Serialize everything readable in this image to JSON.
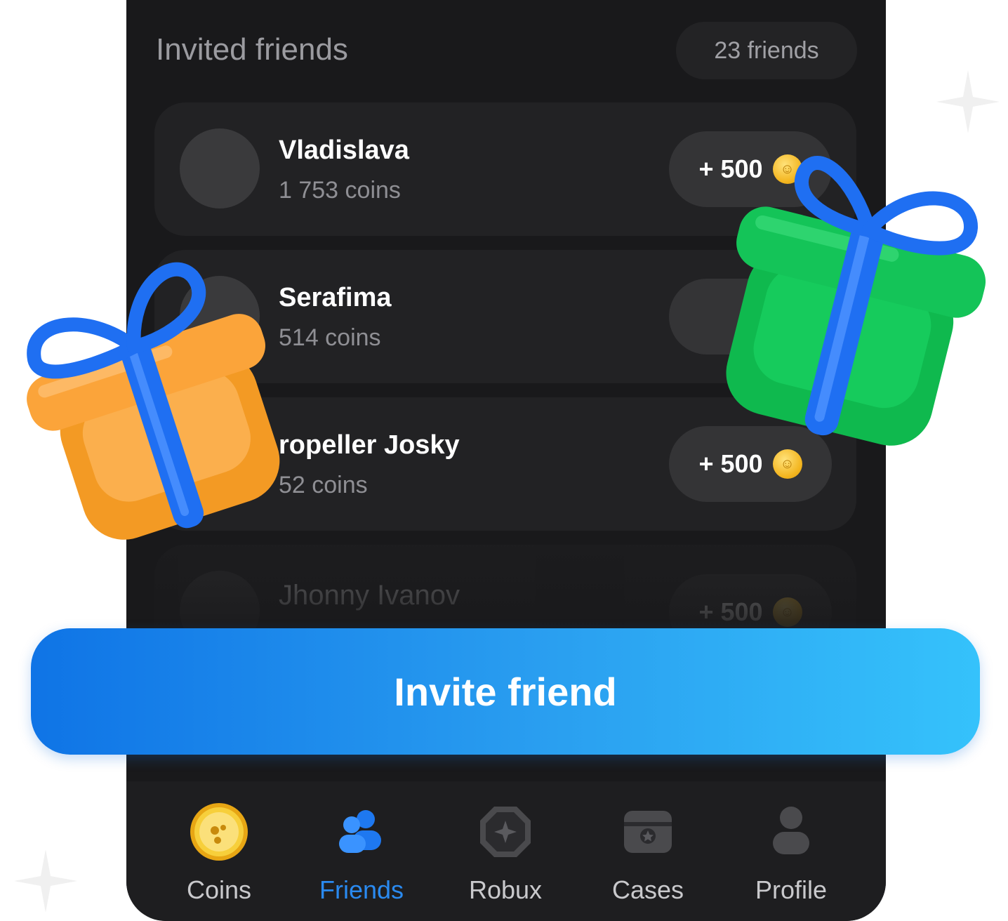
{
  "header": {
    "title": "Invited friends",
    "count": "23 friends"
  },
  "friends": [
    {
      "name": "Vladislava",
      "coins": "1 753 coins",
      "reward": "+ 500"
    },
    {
      "name": "Serafima",
      "coins": "514 coins",
      "reward": "+"
    },
    {
      "name": "ropeller Josky",
      "coins": "52 coins",
      "reward": "+ 500"
    },
    {
      "name": "Jhonny Ivanov",
      "coins": "",
      "reward": "+ 500"
    }
  ],
  "invite_button": {
    "label": "Invite friend"
  },
  "tabs": [
    {
      "label": "Coins",
      "icon": "coin-icon",
      "active": false
    },
    {
      "label": "Friends",
      "icon": "friends-icon",
      "active": true
    },
    {
      "label": "Robux",
      "icon": "robux-icon",
      "active": false
    },
    {
      "label": "Cases",
      "icon": "case-icon",
      "active": false
    },
    {
      "label": "Profile",
      "icon": "profile-icon",
      "active": false
    }
  ],
  "colors": {
    "accent": "#2a8af0",
    "background": "#19191b",
    "card": "#222224",
    "coin": "#f3b51f",
    "gift_orange": "#fba43a",
    "gift_green": "#14c458",
    "ribbon": "#1f6ff2"
  }
}
